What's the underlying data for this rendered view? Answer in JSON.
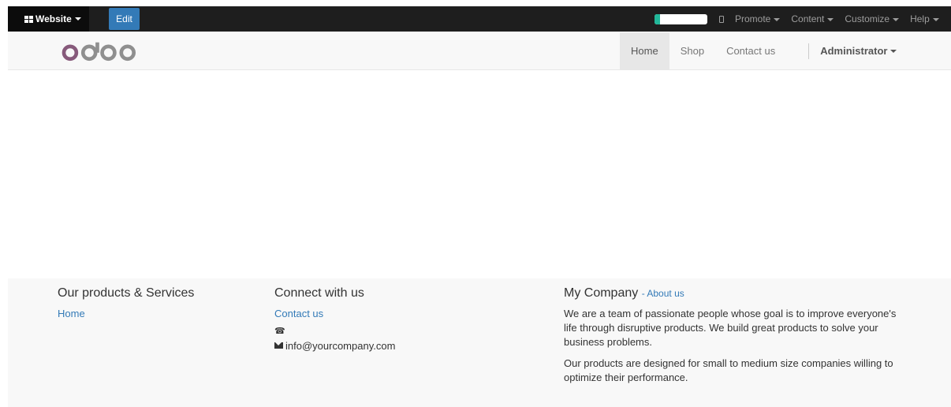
{
  "admin_bar": {
    "website_label": "Website",
    "edit_label": "Edit",
    "progress_fraction": 0.1,
    "items": [
      {
        "label": "Promote"
      },
      {
        "label": "Content"
      },
      {
        "label": "Customize"
      },
      {
        "label": "Help"
      }
    ]
  },
  "navbar": {
    "logo_text": "odoo",
    "links": [
      {
        "label": "Home",
        "active": true
      },
      {
        "label": "Shop"
      },
      {
        "label": "Contact us"
      }
    ],
    "user_label": "Administrator"
  },
  "footer": {
    "products": {
      "heading": "Our products & Services",
      "link": "Home"
    },
    "connect": {
      "heading": "Connect with us",
      "link": "Contact us",
      "phone": "",
      "email": "info@yourcompany.com"
    },
    "company": {
      "heading": "My Company",
      "about_link": "- About us",
      "para1": "We are a team of passionate people whose goal is to improve everyone's life through disruptive products. We build great products to solve your business problems.",
      "para2": "Our products are designed for small to medium size companies willing to optimize their performance."
    }
  },
  "colors": {
    "admin_bar": "#1e1e1e",
    "edit_button": "#337ab7",
    "link": "#337ab7",
    "odoo_purple": "#875a7b",
    "odoo_grey": "#8f8f8f"
  }
}
